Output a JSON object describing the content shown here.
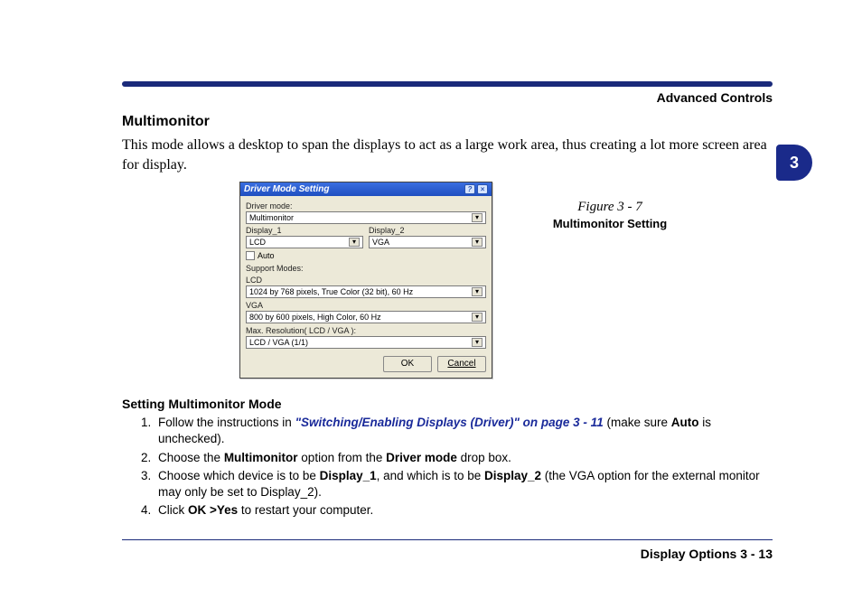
{
  "header": {
    "right": "Advanced Controls"
  },
  "chapter": {
    "number": "3"
  },
  "section": {
    "title": "Multimonitor",
    "intro": "This mode allows a desktop to span the displays to act as a large work area, thus creating a lot more screen area for display."
  },
  "dialog": {
    "title": "Driver Mode Setting",
    "groups": {
      "driver_mode": {
        "label": "Driver mode:",
        "value": "Multimonitor"
      },
      "display1": {
        "label": "Display_1",
        "value": "LCD"
      },
      "display2": {
        "label": "Display_2",
        "value": "VGA"
      },
      "auto": {
        "label": "Auto",
        "checked": false
      },
      "support_modes": {
        "label": "Support Modes:"
      },
      "lcd": {
        "label": "LCD",
        "value": "1024 by 768 pixels, True Color (32 bit), 60 Hz"
      },
      "vga": {
        "label": "VGA",
        "value": "800 by 600 pixels, High Color, 60 Hz"
      },
      "max_res": {
        "label": "Max. Resolution( LCD   / VGA  ):",
        "value": "LCD   / VGA   (1/1)"
      }
    },
    "buttons": {
      "ok": "OK",
      "cancel": "Cancel"
    }
  },
  "figure": {
    "number": "Figure 3 - 7",
    "name": "Multimonitor Setting"
  },
  "steps": {
    "heading": "Setting Multimonitor Mode",
    "items": {
      "s1": {
        "prefix": "Follow the instructions in ",
        "link": "\"Switching/Enabling Displays (Driver)\" on page 3 - 11",
        "suffix_a": " (make sure ",
        "bold_a": "Auto",
        "suffix_b": " is unchecked)."
      },
      "s2": {
        "prefix": "Choose the ",
        "bold_a": "Multimonitor",
        "mid": " option from the ",
        "bold_b": "Driver mode",
        "suffix": " drop box."
      },
      "s3": {
        "prefix": "Choose which device is to be ",
        "bold_a": "Display_1",
        "mid": ", and which is to be ",
        "bold_b": "Display_2",
        "suffix": " (the VGA option for the external monitor may only be set to Display_2)."
      },
      "s4": {
        "prefix": "Click ",
        "bold_a": "OK >Yes",
        "suffix": " to restart your computer."
      }
    }
  },
  "footer": {
    "right": "Display Options  3  -  13"
  }
}
